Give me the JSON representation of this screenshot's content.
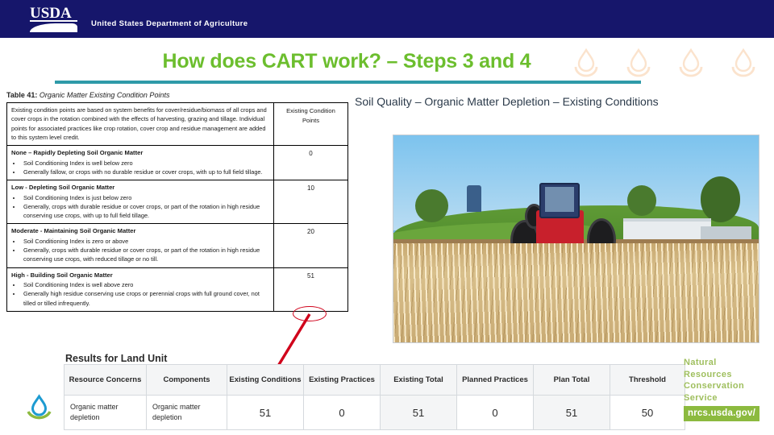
{
  "header": {
    "agency_abbrev": "USDA",
    "agency_name": "United States Department of Agriculture",
    "bar_color": "#16166b"
  },
  "title": {
    "text": "How does CART work? – Steps 3 and 4",
    "color": "#6cbe2e",
    "rule_color": "#2e9aa8"
  },
  "subtitle": {
    "text": "Soil Quality – Organic Matter Depletion – Existing Conditions"
  },
  "photo": {
    "alt": "Red tractor pulling a blue planter through corn residue stubble field"
  },
  "table41": {
    "caption_label": "Table 41:",
    "caption_title": "Organic Matter Existing Condition Points",
    "header": {
      "description": "Existing condition points are based on system benefits for cover/residue/biomass of all crops and cover crops in the rotation combined with the effects of harvesting, grazing and tillage. Individual points for associated practices like crop rotation, cover crop and residue management are added to this system level credit.",
      "points": "Existing Condition Points"
    },
    "rows": [
      {
        "title": "None – Rapidly Depleting Soil Organic Matter",
        "bullets": [
          "Soil Conditioning Index is well below zero",
          "Generally fallow, or crops with no durable residue or cover crops, with up to full field tillage."
        ],
        "points": "0",
        "circled": false
      },
      {
        "title": "Low - Depleting Soil Organic Matter",
        "bullets": [
          "Soil Conditioning Index is just below zero",
          "Generally, crops with durable residue or cover crops, or part of the rotation in high residue conserving use crops, with up to full field tillage."
        ],
        "points": "10",
        "circled": false
      },
      {
        "title": "Moderate - Maintaining Soil Organic Matter",
        "bullets": [
          "Soil Conditioning Index is zero or above",
          "Generally, crops with durable residue or cover crops, or part of the rotation in high residue conserving use crops, with reduced tillage or no till."
        ],
        "points": "20",
        "circled": false
      },
      {
        "title": "High - Building Soil Organic Matter",
        "bullets": [
          "Soil Conditioning Index is well above zero",
          "Generally high residue conserving use crops or perennial crops with full ground cover, not tilled or tilled infrequently."
        ],
        "points": "51",
        "circled": true
      }
    ],
    "annotation_color": "#d0021b"
  },
  "results": {
    "title": "Results for Land Unit",
    "columns": [
      "Resource Concerns",
      "Components",
      "Existing Conditions",
      "Existing Practices",
      "Existing Total",
      "Planned Practices",
      "Plan Total",
      "Threshold"
    ],
    "row": {
      "resource_concerns": "Organic matter depletion",
      "components": "Organic matter depletion",
      "existing_conditions": "51",
      "existing_practices": "0",
      "existing_total": "51",
      "planned_practices": "0",
      "plan_total": "51",
      "threshold": "50"
    }
  },
  "footer": {
    "nrcs_line1": "Natural",
    "nrcs_line2": "Resources",
    "nrcs_line3": "Conservation",
    "nrcs_line4": "Service",
    "url": "nrcs.usda.gov/",
    "url_bg": "#8cba3f",
    "text_color": "#9fbf5e"
  }
}
